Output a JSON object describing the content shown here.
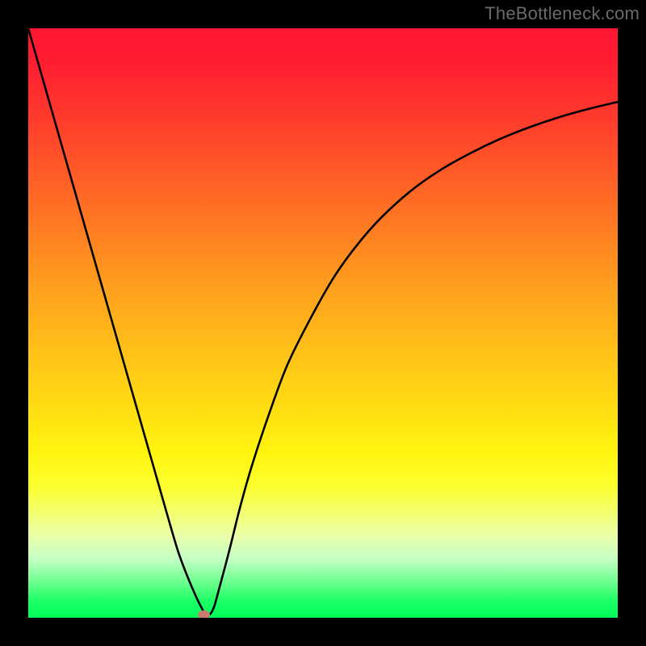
{
  "watermark": "TheBottleneck.com",
  "chart_data": {
    "type": "line",
    "title": "",
    "xlabel": "",
    "ylabel": "",
    "xlim": [
      0,
      100
    ],
    "ylim": [
      0,
      100
    ],
    "grid": false,
    "legend": false,
    "series": [
      {
        "name": "bottleneck-curve",
        "x": [
          0,
          2,
          4,
          6,
          8,
          10,
          12,
          14,
          16,
          18,
          20,
          22,
          24,
          25.5,
          27,
          28.5,
          29.5,
          30,
          30.5,
          31,
          31.5,
          32,
          34,
          36,
          38,
          41,
          44,
          48,
          52,
          56,
          60,
          65,
          70,
          75,
          80,
          85,
          90,
          95,
          100
        ],
        "y": [
          100,
          93,
          86,
          79,
          72,
          65,
          58,
          51,
          44,
          37,
          30,
          23,
          16,
          11,
          7,
          3.5,
          1.5,
          0.6,
          0.4,
          0.8,
          1.8,
          3.5,
          11,
          19,
          26,
          35,
          43,
          51,
          58,
          63.5,
          68,
          72.5,
          76,
          78.8,
          81.2,
          83.2,
          84.9,
          86.3,
          87.5
        ]
      }
    ],
    "marker": {
      "name": "balance-point",
      "x": 29.8,
      "y": 0.5,
      "color": "#c97b6f"
    },
    "background_gradient": {
      "top": "#ff1533",
      "bottom": "#00ff57"
    }
  }
}
